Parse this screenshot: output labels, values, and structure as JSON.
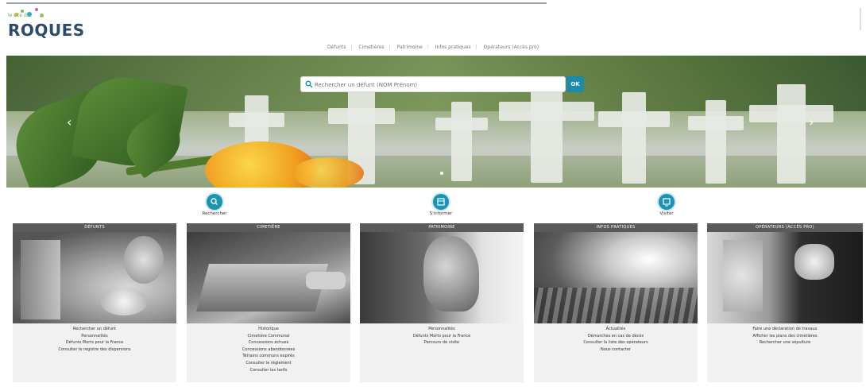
{
  "logo": {
    "small_text": "le site de",
    "name": "ROQUES"
  },
  "nav": [
    "Défunts",
    "Cimetières",
    "Patrimoine",
    "Infos pratiques",
    "Opérateurs (Accès pro)"
  ],
  "search": {
    "placeholder": "Rechercher un défunt (NOM Prénom)",
    "button": "OK"
  },
  "hero": {
    "prev_arrow": "‹",
    "next_arrow": "›"
  },
  "features": [
    {
      "icon": "search-icon",
      "label": "Rechercher"
    },
    {
      "icon": "calendar-icon",
      "label": "S'informer"
    },
    {
      "icon": "screen-icon",
      "label": "Visiter"
    }
  ],
  "cards": [
    {
      "title": "Défunts",
      "links": [
        "Rechercher un défunt",
        "Personnalités",
        "Défunts Morts pour la France",
        "Consulter le registre des dispersions"
      ]
    },
    {
      "title": "Cimetière",
      "links": [
        "Historique",
        "Cimetière Communal",
        "Concessions échues",
        "Concessions abandonnées",
        "Terrains communs expirés",
        "Consulter le règlement",
        "Consulter les tarifs"
      ]
    },
    {
      "title": "Patrimoine",
      "links": [
        "Personnalités",
        "Défunts Morts pour la France",
        "Parcours de visite"
      ]
    },
    {
      "title": "Infos pratiques",
      "links": [
        "Actualités",
        "Démarches en cas de décès",
        "Consulter la liste des opérateurs",
        "Nous contacter"
      ]
    },
    {
      "title": "Opérateurs (accès pro)",
      "links": [
        "Faire une déclaration de travaux",
        "Afficher les plans des cimetières",
        "Rechercher une sépulture"
      ]
    }
  ],
  "colors": {
    "accent": "#1a93b5",
    "ok_button": "#1c8aa8",
    "card_head": "#5a5a5a",
    "logo": "#2b4b6e"
  }
}
